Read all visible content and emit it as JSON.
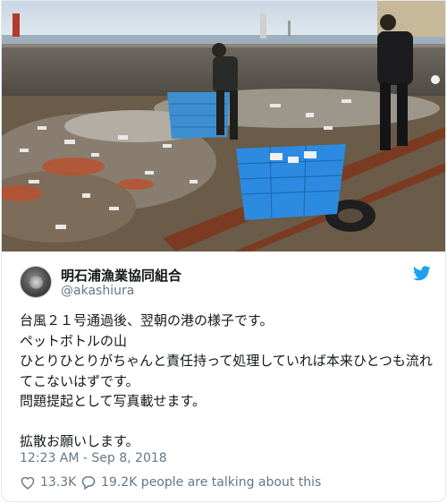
{
  "tweet": {
    "author": {
      "display_name": "明石浦漁業協同組合",
      "handle": "@akashiura",
      "avatar_icon": "avatar-image"
    },
    "text": "台風２１号通過後、翌朝の港の様子です。\nペットボトルの山\nひとりひとりがちゃんと責任持って処理していれば本来ひとつも流れてこないはずです。\n問題提起として写真載せます。\n\n拡散お願いします。",
    "timestamp": "12:23 AM - Sep 8, 2018",
    "likes": "13.3K",
    "replies_text": "19.2K people are talking about this",
    "icons": {
      "brand": "twitter-bird-icon",
      "like": "heart-icon",
      "reply": "speech-bubble-icon"
    },
    "colors": {
      "brand": "#1da1f2",
      "secondary_text": "#657786",
      "border": "#e1e8ed"
    }
  }
}
